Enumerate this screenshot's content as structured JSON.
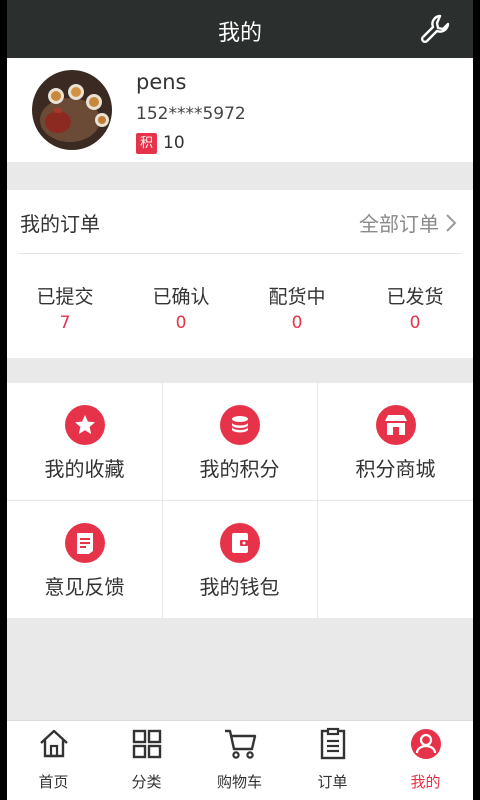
{
  "header": {
    "title": "我的",
    "settings_icon": "wrench-icon"
  },
  "profile": {
    "username": "pens",
    "phone": "152****5972",
    "points_badge": "积",
    "points": "10"
  },
  "orders": {
    "title": "我的订单",
    "all_label": "全部订单",
    "statuses": [
      {
        "label": "已提交",
        "count": "7"
      },
      {
        "label": "已确认",
        "count": "0"
      },
      {
        "label": "配货中",
        "count": "0"
      },
      {
        "label": "已发货",
        "count": "0"
      }
    ]
  },
  "menu": [
    {
      "label": "我的收藏",
      "icon": "star-icon"
    },
    {
      "label": "我的积分",
      "icon": "coins-icon"
    },
    {
      "label": "积分商城",
      "icon": "store-icon"
    },
    {
      "label": "意见反馈",
      "icon": "feedback-icon"
    },
    {
      "label": "我的钱包",
      "icon": "wallet-icon"
    }
  ],
  "tabs": [
    {
      "label": "首页",
      "icon": "home-icon"
    },
    {
      "label": "分类",
      "icon": "category-icon"
    },
    {
      "label": "购物车",
      "icon": "cart-icon"
    },
    {
      "label": "订单",
      "icon": "orders-icon"
    },
    {
      "label": "我的",
      "icon": "profile-icon",
      "active": true
    }
  ],
  "colors": {
    "accent": "#e6334a",
    "header_bg": "#2b2f2d",
    "page_bg": "#e9e9e9"
  }
}
